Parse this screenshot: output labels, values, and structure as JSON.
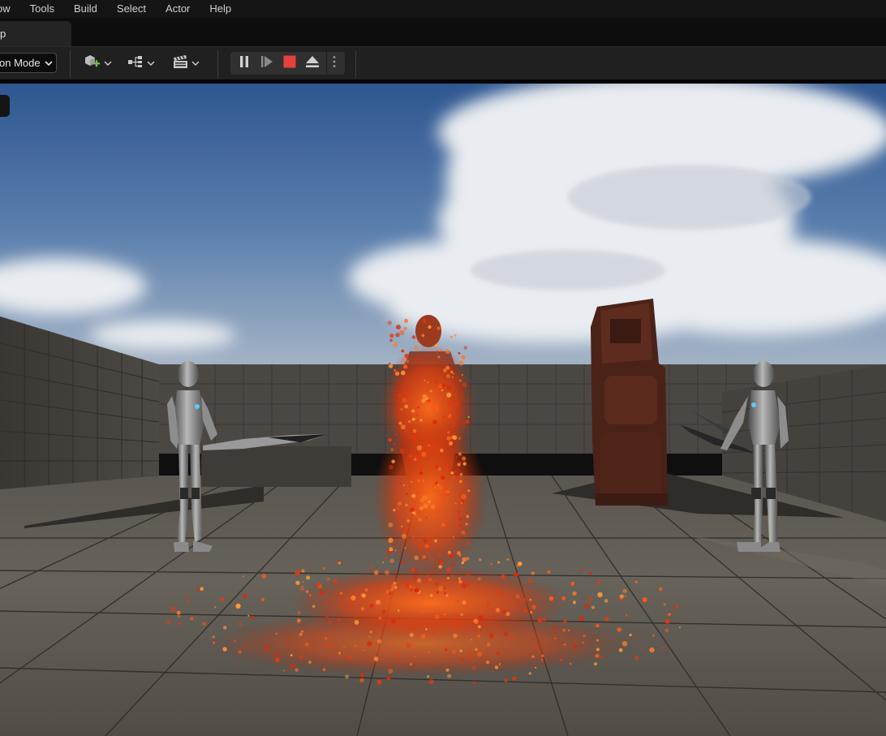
{
  "menu": [
    "ow",
    "Tools",
    "Build",
    "Select",
    "Actor",
    "Help"
  ],
  "tab": {
    "label": "p"
  },
  "toolbar": {
    "mode_label": "on Mode",
    "icons": {
      "add": "add-actor-icon",
      "blueprint": "blueprint-icon",
      "cinematics": "cinematics-clapper-icon",
      "pause": "pause-icon",
      "step": "frame-step-icon",
      "stop": "stop-icon",
      "eject": "eject-icon",
      "more": "more-options-icon"
    },
    "colors": {
      "add_plus": "#6fbf3a",
      "stop": "#e8403c"
    }
  },
  "viewport": {
    "description_icon": "viewport-options-icon"
  }
}
